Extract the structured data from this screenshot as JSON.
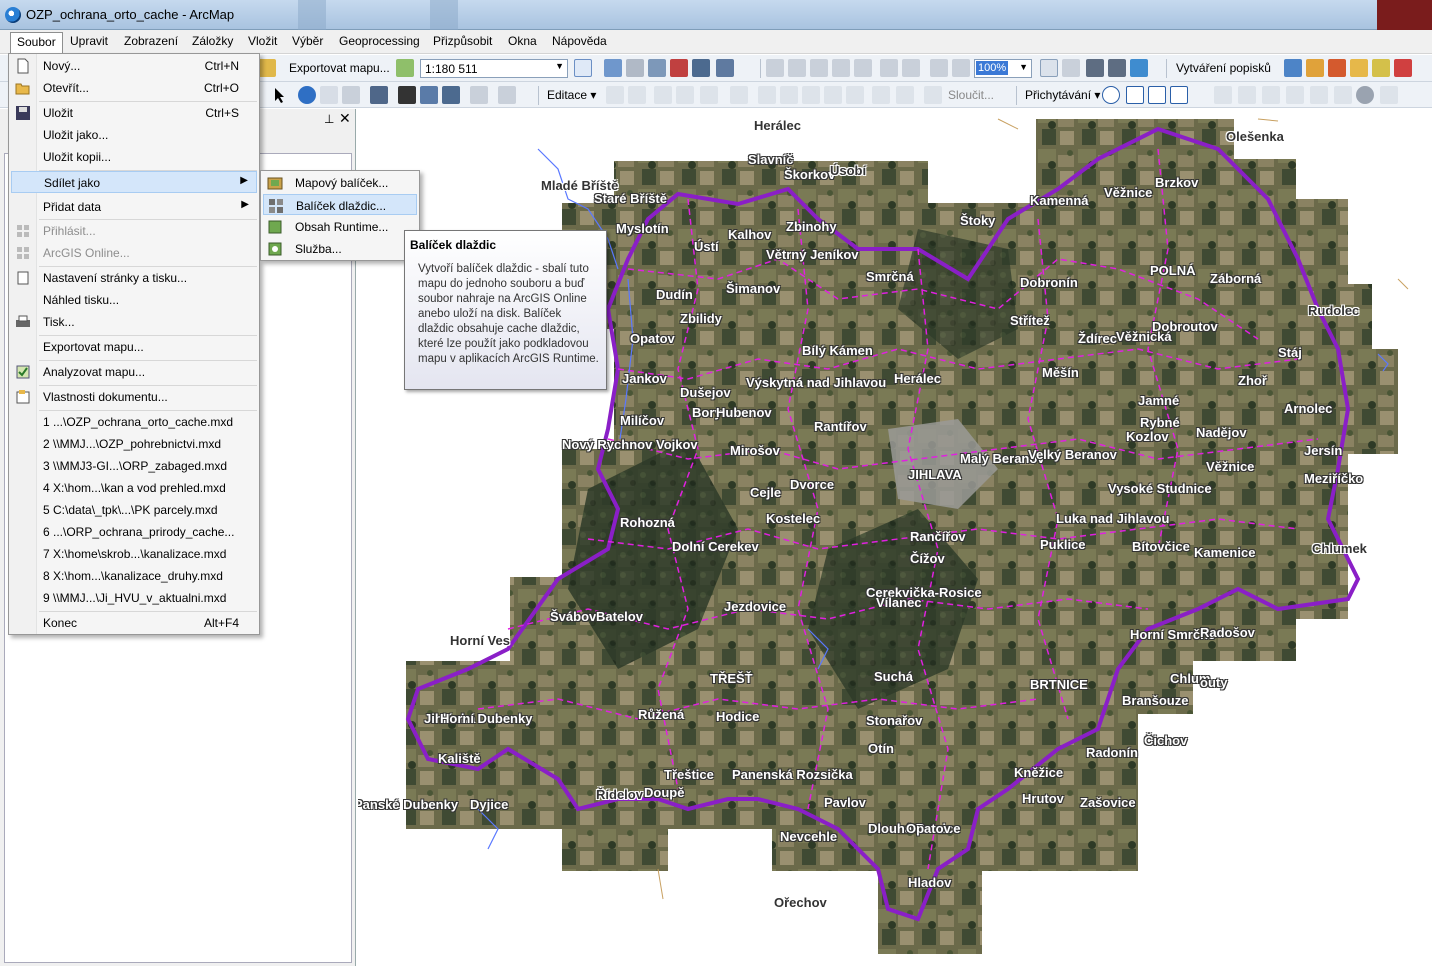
{
  "window": {
    "title": "OZP_ochrana_orto_cache - ArcMap"
  },
  "menubar": {
    "items": [
      {
        "label": "Soubor",
        "active": true
      },
      {
        "label": "Upravit"
      },
      {
        "label": "Zobrazení"
      },
      {
        "label": "Záložky"
      },
      {
        "label": "Vložit"
      },
      {
        "label": "Výběr"
      },
      {
        "label": "Geoprocessing"
      },
      {
        "label": "Přizpůsobit"
      },
      {
        "label": "Okna"
      },
      {
        "label": "Nápověda"
      }
    ]
  },
  "toolbar": {
    "export_label": "Exportovat mapu...",
    "scale": "1:180 511",
    "zoom": "100%",
    "labeling_label": "Vytváření popisků",
    "editor_label": "Editace",
    "merge_label": "Sloučit...",
    "snapping_label": "Přichytávání"
  },
  "file_menu": {
    "items": [
      {
        "label": "Nový...",
        "shortcut": "Ctrl+N"
      },
      {
        "label": "Otevřít...",
        "shortcut": "Ctrl+O"
      },
      {
        "label": "Uložit",
        "shortcut": "Ctrl+S"
      },
      {
        "label": "Uložit jako..."
      },
      {
        "label": "Uložit kopii..."
      },
      {
        "label": "Sdílet jako"
      },
      {
        "label": "Přidat data"
      },
      {
        "label": "Přihlásit..."
      },
      {
        "label": "ArcGIS Online..."
      },
      {
        "label": "Nastavení stránky a tisku..."
      },
      {
        "label": "Náhled tisku..."
      },
      {
        "label": "Tisk..."
      },
      {
        "label": "Exportovat mapu..."
      },
      {
        "label": "Analyzovat mapu..."
      },
      {
        "label": "Vlastnosti dokumentu..."
      },
      {
        "label": "1 ...\\OZP_ochrana_orto_cache.mxd"
      },
      {
        "label": "2 \\\\MMJ...\\OZP_pohrebnictvi.mxd"
      },
      {
        "label": "3 \\\\MMJ3-GI...\\ORP_zabaged.mxd"
      },
      {
        "label": "4 X:\\hom...\\kan a vod prehled.mxd"
      },
      {
        "label": "5 C:\\data\\_tpk\\...\\PK parcely.mxd"
      },
      {
        "label": "6 ...\\ORP_ochrana_prirody_cache..."
      },
      {
        "label": "7 X:\\home\\skrob...\\kanalizace.mxd"
      },
      {
        "label": "8 X:\\hom...\\kanalizace_druhy.mxd"
      },
      {
        "label": "9 \\\\MMJ...\\Ji_HVU_v_aktualni.mxd"
      },
      {
        "label": "Konec",
        "shortcut": "Alt+F4"
      }
    ]
  },
  "share_submenu": {
    "items": [
      {
        "label": "Mapový balíček..."
      },
      {
        "label": "Balíček dlaždic..."
      },
      {
        "label": "Obsah Runtime..."
      },
      {
        "label": "Služba..."
      }
    ]
  },
  "tooltip": {
    "title": "Balíček dlaždic",
    "body": "Vytvoří balíček dlaždic - sbalí tuto mapu do jednoho souboru a buď soubor nahraje na ArcGIS Online anebo uloží na disk. Balíček dlaždic obsahuje cache dlaždic, které lze použít jako podkladovou mapu v aplikacích ArcGIS Runtime."
  },
  "colors": {
    "menu_highlight": "#d4e6fa",
    "district_border": "#8a1fc7",
    "municipal_border": "#e020e0",
    "water": "#5a78ff"
  },
  "map_places": [
    {
      "name": "Herálec",
      "outside": true
    },
    {
      "name": "Olešenka",
      "outside": true
    },
    {
      "name": "Slavníč"
    },
    {
      "name": "Škorkov"
    },
    {
      "name": "Úsobí",
      "outside": true
    },
    {
      "name": "Mladé Bříště",
      "outside": true
    },
    {
      "name": "Staré Bříště"
    },
    {
      "name": "Zbinohy"
    },
    {
      "name": "Štoky"
    },
    {
      "name": "Kamenná"
    },
    {
      "name": "Věžnice"
    },
    {
      "name": "Brzkov"
    },
    {
      "name": "Myslotín"
    },
    {
      "name": "Kalhov"
    },
    {
      "name": "Ústí"
    },
    {
      "name": "Větrný Jeníkov"
    },
    {
      "name": "Smrčná"
    },
    {
      "name": "Dobronín"
    },
    {
      "name": "POLNÁ"
    },
    {
      "name": "Záborná"
    },
    {
      "name": "Šimanov"
    },
    {
      "name": "Dudín"
    },
    {
      "name": "Zbilidy"
    },
    {
      "name": "Střítež"
    },
    {
      "name": "Dobroutov"
    },
    {
      "name": "Rudolec",
      "outside": true
    },
    {
      "name": "Opatov"
    },
    {
      "name": "Ždírec"
    },
    {
      "name": "Věžnická"
    },
    {
      "name": "Bílý Kámen"
    },
    {
      "name": "Stáj"
    },
    {
      "name": "Jankov"
    },
    {
      "name": "Výskytná nad Jihlavou"
    },
    {
      "name": "Herálec"
    },
    {
      "name": "Měšín"
    },
    {
      "name": "Zhoř"
    },
    {
      "name": "Dušejov"
    },
    {
      "name": "Bory"
    },
    {
      "name": "Hubenov"
    },
    {
      "name": "Jamné"
    },
    {
      "name": "Arnolec"
    },
    {
      "name": "Milíčov"
    },
    {
      "name": "Rantířov"
    },
    {
      "name": "Rybné"
    },
    {
      "name": "Nadějov"
    },
    {
      "name": "Kozlov"
    },
    {
      "name": "Nový Rychnov"
    },
    {
      "name": "Vojkov"
    },
    {
      "name": "Mirošov"
    },
    {
      "name": "Malý Beranov"
    },
    {
      "name": "Velký Beranov"
    },
    {
      "name": "Jersín"
    },
    {
      "name": "Věžnice"
    },
    {
      "name": "JIHLAVA"
    },
    {
      "name": "Meziříčko"
    },
    {
      "name": "Dvorce"
    },
    {
      "name": "Cejle"
    },
    {
      "name": "Vysoké Studnice"
    },
    {
      "name": "Kostelec"
    },
    {
      "name": "Rohozná"
    },
    {
      "name": "Luka nad Jihlavou"
    },
    {
      "name": "Rančířov"
    },
    {
      "name": "Dolní Cerekev"
    },
    {
      "name": "Puklice"
    },
    {
      "name": "Bítovčice"
    },
    {
      "name": "Kamenice"
    },
    {
      "name": "Chlumek",
      "outside": true
    },
    {
      "name": "Čížov"
    },
    {
      "name": "Cerekvička-Rosice"
    },
    {
      "name": "Vílanec"
    },
    {
      "name": "Švábov"
    },
    {
      "name": "Batelov"
    },
    {
      "name": "Jezdovice"
    },
    {
      "name": "Horní Ves",
      "outside": true
    },
    {
      "name": "Horní Smrčné"
    },
    {
      "name": "Radošov"
    },
    {
      "name": "TŘEŠŤ"
    },
    {
      "name": "Suchá"
    },
    {
      "name": "BRTNICE"
    },
    {
      "name": "Chlum"
    },
    {
      "name": "outy"
    },
    {
      "name": "Branšouze"
    },
    {
      "name": "Jihlávka"
    },
    {
      "name": "Horní Dubenky"
    },
    {
      "name": "Růžená"
    },
    {
      "name": "Hodice"
    },
    {
      "name": "Stonařov"
    },
    {
      "name": "Otín"
    },
    {
      "name": "Radonín"
    },
    {
      "name": "Čichov"
    },
    {
      "name": "Kaliště"
    },
    {
      "name": "Třeštice"
    },
    {
      "name": "Panenská Rozsička"
    },
    {
      "name": "Kněžice"
    },
    {
      "name": "Hrutov"
    },
    {
      "name": "Zašovice"
    },
    {
      "name": "Řídelov",
      "outside": true
    },
    {
      "name": "Doupě"
    },
    {
      "name": "Panské Dubenky"
    },
    {
      "name": "Dyjice"
    },
    {
      "name": "Pavlov"
    },
    {
      "name": "Nevcehle"
    },
    {
      "name": "Dlouhá Brtnice"
    },
    {
      "name": "Opatov"
    },
    {
      "name": "Hladov"
    },
    {
      "name": "Ořechov",
      "outside": true
    }
  ]
}
